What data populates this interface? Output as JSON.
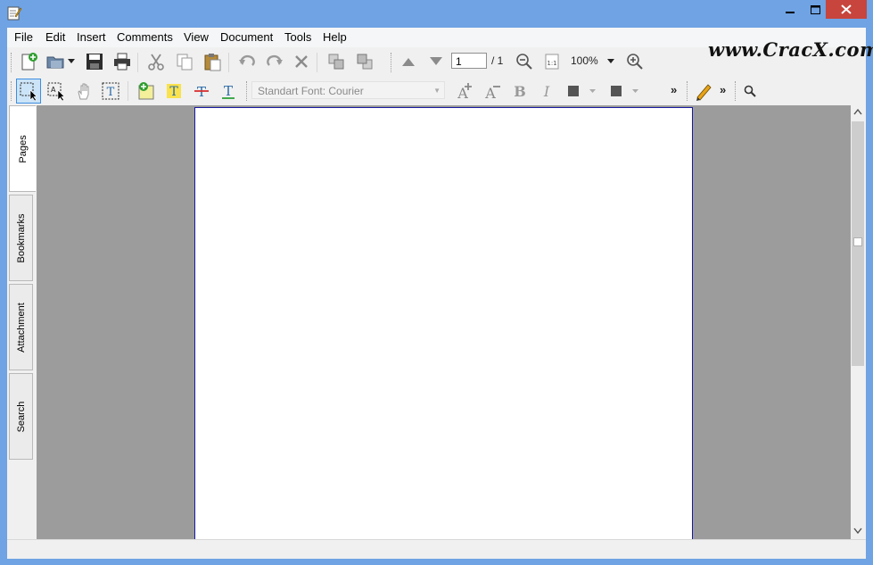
{
  "window": {
    "controls": {
      "minimize": "minimize",
      "maximize": "maximize",
      "close": "close"
    }
  },
  "menu": {
    "items": [
      "File",
      "Edit",
      "Insert",
      "Comments",
      "View",
      "Document",
      "Tools",
      "Help"
    ]
  },
  "watermark": "www.CracX.com",
  "toolbar1": {
    "page_number": "1",
    "page_total": "/ 1",
    "zoom": "100%",
    "actual_size_label": "1:1"
  },
  "toolbar2": {
    "font_selector": "Standart Font: Courier",
    "bold_label": "B",
    "italic_label": "I",
    "overflow1": "»",
    "overflow2": "»"
  },
  "side_tabs": [
    "Pages",
    "Bookmarks",
    "Attachment",
    "Search"
  ],
  "colors": {
    "titlebar": "#6fa3e4",
    "close_button": "#c7453c",
    "viewer_bg": "#9c9c9c",
    "page_border": "#1a1aa0"
  }
}
